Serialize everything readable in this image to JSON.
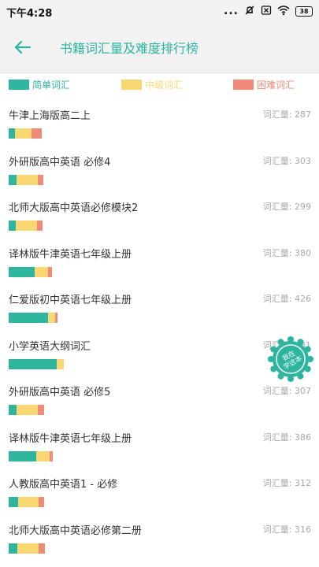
{
  "status_bar": {
    "time": "下午4:28",
    "dots": "...",
    "battery": "38",
    "icons": [
      "mute-icon",
      "sim-x-icon",
      "wifi-icon",
      "battery-icon"
    ]
  },
  "header": {
    "title": "书籍词汇量及难度排行榜",
    "back_icon": "arrow-left-icon"
  },
  "colors": {
    "easy": "#2db59e",
    "medium": "#f9d873",
    "hard": "#ef8b78",
    "accent": "#2db59e"
  },
  "legend": [
    {
      "label": "简单词汇",
      "color": "#2db59e"
    },
    {
      "label": "中级词汇",
      "color": "#f9d873"
    },
    {
      "label": "困难词汇",
      "color": "#ef8b78"
    }
  ],
  "books": [
    {
      "name": "牛津上海版高二上",
      "vocab_text": "词汇量: 287",
      "easy_ratio": 0.19,
      "medium_ratio": 0.51,
      "hard_ratio": 0.3
    },
    {
      "name": "外研版高中英语 必修4",
      "vocab_text": "词汇量: 303",
      "easy_ratio": 0.22,
      "medium_ratio": 0.63,
      "hard_ratio": 0.15
    },
    {
      "name": "北师大版高中英语必修模块2",
      "vocab_text": "词汇量: 299",
      "easy_ratio": 0.21,
      "medium_ratio": 0.61,
      "hard_ratio": 0.18
    },
    {
      "name": "译林版牛津英语七年级上册",
      "vocab_text": "词汇量: 380",
      "easy_ratio": 0.6,
      "medium_ratio": 0.31,
      "hard_ratio": 0.09
    },
    {
      "name": "仁爱版初中英语七年级上册",
      "vocab_text": "词汇量: 426",
      "easy_ratio": 0.8,
      "medium_ratio": 0.15,
      "hard_ratio": 0.05
    },
    {
      "name": "小学英语大纲词汇",
      "vocab_text": "词汇量: 481",
      "easy_ratio": 0.87,
      "medium_ratio": 0.13,
      "hard_ratio": 0.0
    },
    {
      "name": "外研版高中英语 必修5",
      "vocab_text": "词汇量: 307",
      "easy_ratio": 0.22,
      "medium_ratio": 0.62,
      "hard_ratio": 0.16
    },
    {
      "name": "译林版牛津英语七年级上册",
      "vocab_text": "词汇量: 386",
      "easy_ratio": 0.63,
      "medium_ratio": 0.3,
      "hard_ratio": 0.07
    },
    {
      "name": "人教版高中英语1 - 必修",
      "vocab_text": "词汇量: 312",
      "easy_ratio": 0.27,
      "medium_ratio": 0.56,
      "hard_ratio": 0.17
    },
    {
      "name": "北师大版高中英语必修第二册",
      "vocab_text": "词汇量: 316",
      "easy_ratio": 0.23,
      "medium_ratio": 0.6,
      "hard_ratio": 0.17
    }
  ],
  "stamp": {
    "line1": "我在",
    "line2": "学这本"
  }
}
